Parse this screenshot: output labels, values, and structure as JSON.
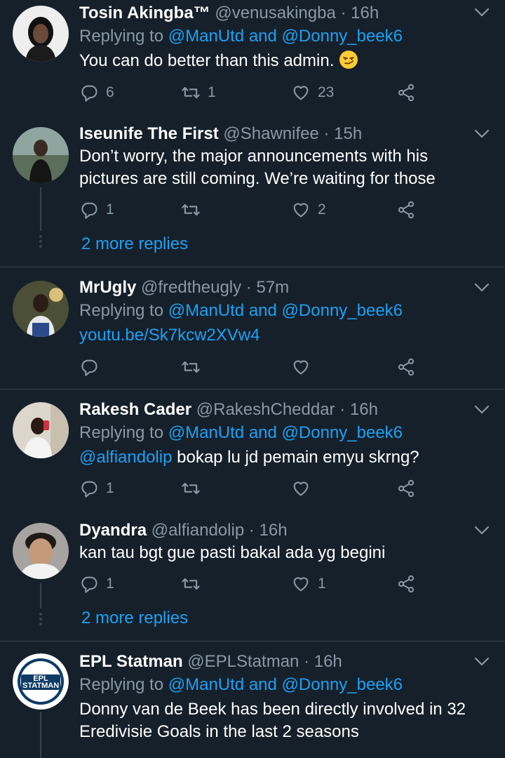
{
  "tweets": [
    {
      "name": "Tosin Akingba™",
      "handle": "@venusakingba",
      "time": "16h",
      "replying_label": "Replying to",
      "reply_mention_1": "@ManUtd",
      "reply_and": "and",
      "reply_mention_2": "@Donny_beek6",
      "text": "You can do better than this admin.",
      "emoji": "smirking-face-emoji",
      "replies": "6",
      "retweets": "1",
      "likes": "23"
    },
    {
      "name": "Iseunife The First",
      "handle": "@Shawnifee",
      "time": "15h",
      "text_line1": "Don’t worry, the major announcements with his",
      "text_line2": "pictures are still coming. We’re waiting for those",
      "replies": "1",
      "retweets": "",
      "likes": "2",
      "more_replies": "2 more replies"
    },
    {
      "name": "MrUgly",
      "handle": "@fredtheugly",
      "time": "57m",
      "replying_label": "Replying to",
      "reply_mention_1": "@ManUtd",
      "reply_and": "and",
      "reply_mention_2": "@Donny_beek6",
      "link": "youtu.be/Sk7kcw2XVw4",
      "replies": "",
      "retweets": "",
      "likes": ""
    },
    {
      "name": "Rakesh Cader",
      "handle": "@RakeshCheddar",
      "time": "16h",
      "replying_label": "Replying to",
      "reply_mention_1": "@ManUtd",
      "reply_and": "and",
      "reply_mention_2": "@Donny_beek6",
      "text_mention": "@alfiandolip",
      "text": "bokap lu jd pemain emyu skrng?",
      "replies": "1",
      "retweets": "",
      "likes": ""
    },
    {
      "name": "Dyandra",
      "handle": "@alfiandolip",
      "time": "16h",
      "text": "kan tau bgt gue pasti bakal ada yg begini",
      "replies": "1",
      "retweets": "",
      "likes": "1",
      "more_replies": "2 more replies"
    },
    {
      "name": "EPL Statman",
      "handle": "@EPLStatman",
      "time": "16h",
      "replying_label": "Replying to",
      "reply_mention_1": "@ManUtd",
      "reply_and": "and",
      "reply_mention_2": "@Donny_beek6",
      "text_line1": "Donny van de Beek has been directly involved in 32",
      "text_line2": "Eredivisie Goals in the last 2 seasons",
      "avatar_logo": "EPL STATMAN"
    }
  ],
  "separator": "·",
  "colors": {
    "background": "#15202b",
    "accent": "#1da1f2",
    "muted": "#8899a6",
    "divider": "#38444d"
  }
}
